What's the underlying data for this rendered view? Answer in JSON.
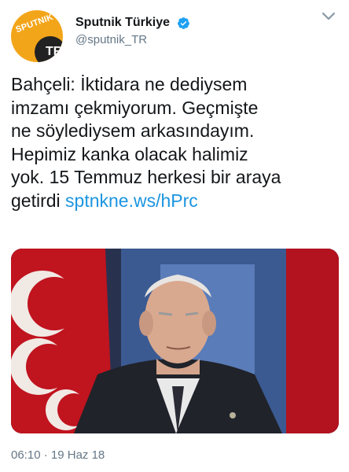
{
  "account": {
    "display_name": "Sputnik Türkiye",
    "handle": "@sputnik_TR",
    "avatar_logo_text": "SPUTNIK",
    "avatar_badge_text": "TR",
    "verified_icon": "verified-badge-icon",
    "brand_color": "#f3a51a"
  },
  "tweet": {
    "text": "Bahçeli: İktidara ne dediysem\nimzamı çekmiyorum. Geçmişte\nne söylediysem arkasındayım.\nHepimiz kanka olacak halimiz\nyok. 15 Temmuz herkesi bir araya\ngetirdi ",
    "link_text": "sptnkne.ws/hPrc",
    "link_color": "#1b95e0",
    "time": "06:10",
    "separator": "·",
    "date": "19 Haz 18"
  },
  "media": {
    "description_icon": "tv-interview-photo"
  },
  "menu": {
    "icon": "chevron-down-icon"
  }
}
